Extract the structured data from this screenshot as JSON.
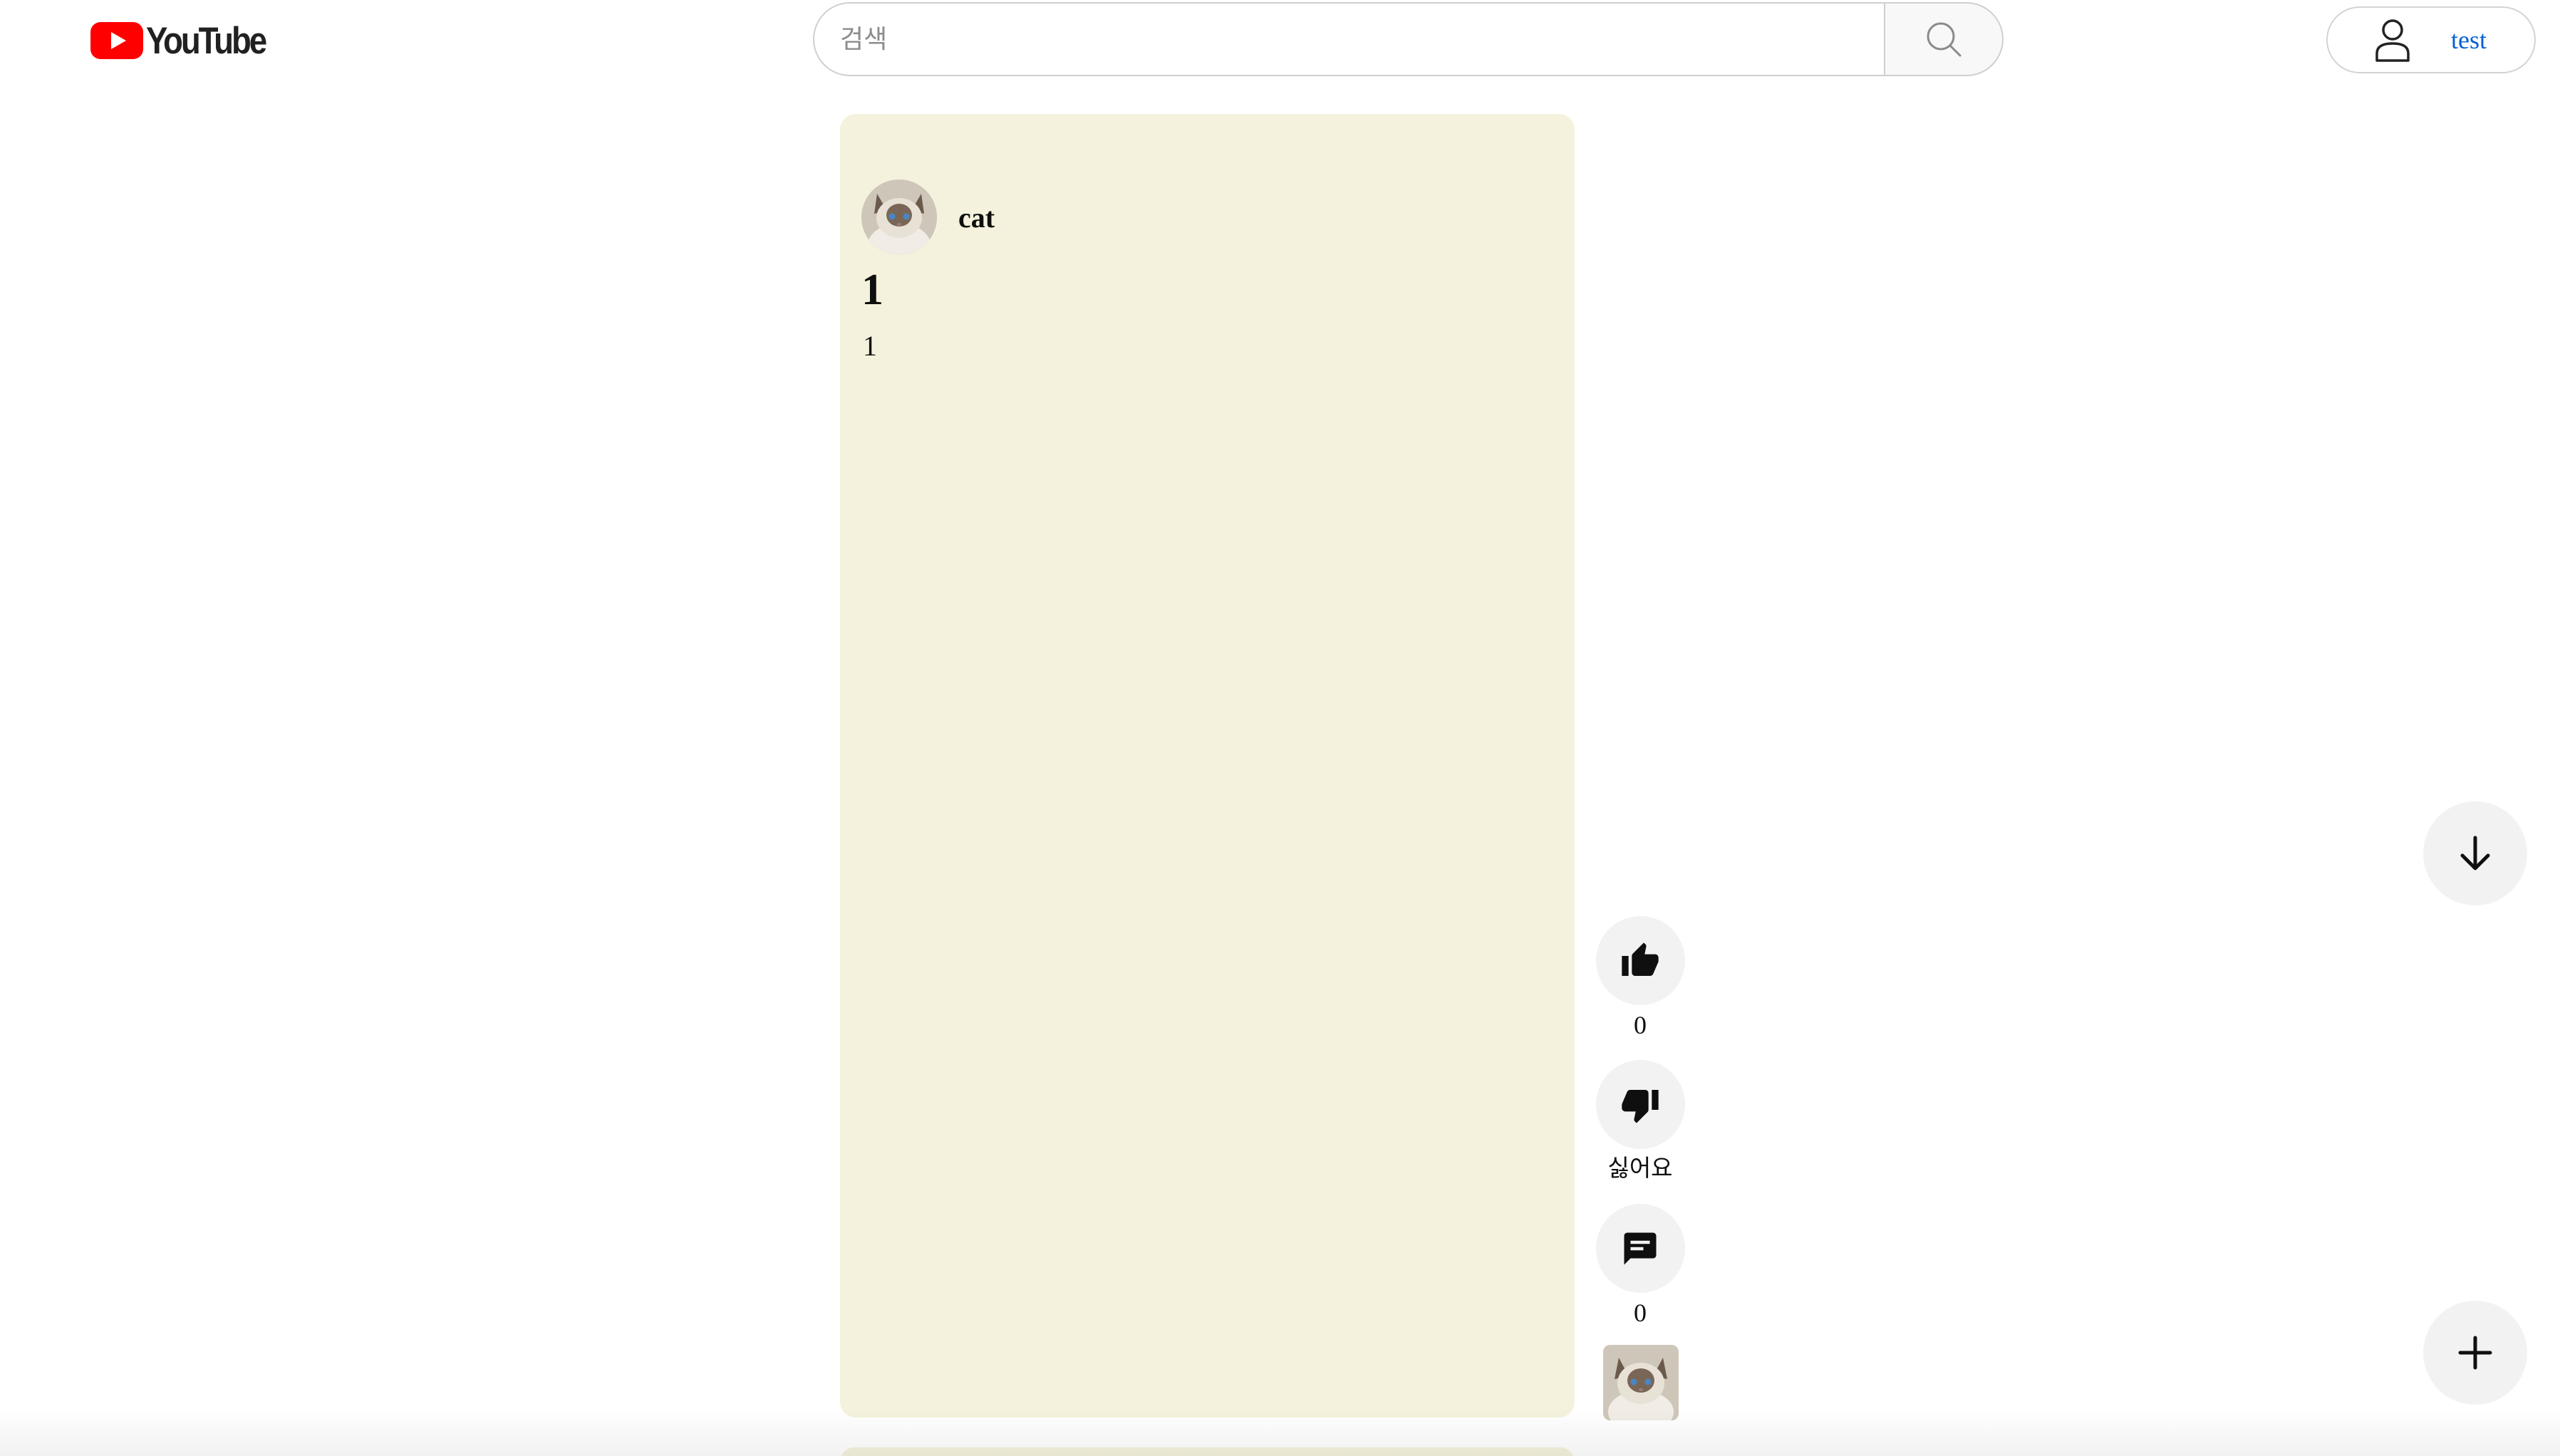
{
  "header": {
    "logo": {
      "wordmark": "YouTube",
      "icon": "youtube-play-icon"
    },
    "search": {
      "placeholder": "검색",
      "value": "",
      "button_icon": "search-icon"
    },
    "account": {
      "icon": "person-icon",
      "name": "test"
    }
  },
  "short": {
    "channel": {
      "avatar": "cat-avatar-image",
      "name": "cat"
    },
    "title": "1",
    "description": "1",
    "background_color": "#f4f2dc"
  },
  "actions": {
    "like": {
      "icon": "thumbs-up-icon",
      "label": "0"
    },
    "dislike": {
      "icon": "thumbs-down-icon",
      "label": "싫어요"
    },
    "comments": {
      "icon": "comment-icon",
      "label": "0"
    },
    "channel_thumbnail": "cat-thumbnail-image"
  },
  "floating": {
    "next": {
      "icon": "arrow-down-icon"
    },
    "create": {
      "icon": "plus-icon"
    }
  },
  "colors": {
    "brand_red": "#ff0000",
    "link_blue": "#065fd4",
    "action_bg": "#f2f2f2"
  }
}
